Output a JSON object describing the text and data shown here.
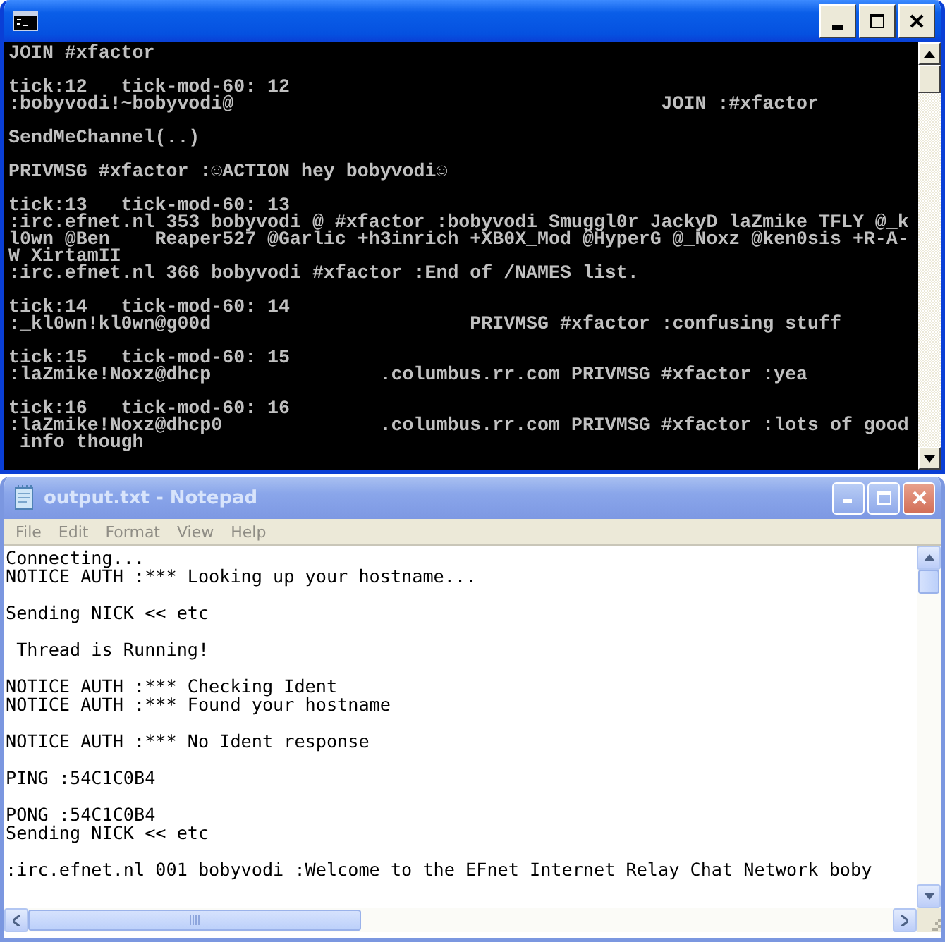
{
  "console": {
    "blocks": [
      [
        "JOIN #xfactor"
      ],
      [
        "tick:12   tick-mod-60: 12",
        ":bobyvodi!~bobyvodi@                                      JOIN :#xfactor"
      ],
      [
        "SendMeChannel(..)"
      ],
      [
        "PRIVMSG #xfactor :☺ACTION hey bobyvodi☺"
      ],
      [
        "tick:13   tick-mod-60: 13",
        ":irc.efnet.nl 353 bobyvodi @ #xfactor :bobyvodi Smuggl0r JackyD laZmike TFLY @_k",
        "l0wn @Ben    Reaper527 @Garlic +h3inrich +XB0X_Mod @HyperG @_Noxz @ken0sis +R-A-",
        "W XirtamII",
        ":irc.efnet.nl 366 bobyvodi #xfactor :End of /NAMES list."
      ],
      [
        "tick:14   tick-mod-60: 14",
        ":_kl0wn!kl0wn@g00d                       PRIVMSG #xfactor :confusing stuff"
      ],
      [
        "tick:15   tick-mod-60: 15",
        ":laZmike!Noxz@dhcp               .columbus.rr.com PRIVMSG #xfactor :yea"
      ],
      [
        "tick:16   tick-mod-60: 16",
        ":laZmike!Noxz@dhcp0              .columbus.rr.com PRIVMSG #xfactor :lots of good",
        " info though"
      ]
    ]
  },
  "notepad": {
    "title": "output.txt - Notepad",
    "menu": [
      {
        "label": "File"
      },
      {
        "label": "Edit"
      },
      {
        "label": "Format"
      },
      {
        "label": "View"
      },
      {
        "label": "Help"
      }
    ],
    "blocks": [
      [
        "Connecting...",
        "NOTICE AUTH :*** Looking up your hostname..."
      ],
      [
        "Sending NICK << etc"
      ],
      [
        " Thread is Running!"
      ],
      [
        "NOTICE AUTH :*** Checking Ident",
        "NOTICE AUTH :*** Found your hostname"
      ],
      [
        "NOTICE AUTH :*** No Ident response"
      ],
      [
        "PING :54C1C0B4"
      ],
      [
        "PONG :54C1C0B4",
        "Sending NICK << etc"
      ],
      [
        ":irc.efnet.nl 001 bobyvodi :Welcome to the EFnet Internet Relay Chat Network boby"
      ]
    ]
  }
}
